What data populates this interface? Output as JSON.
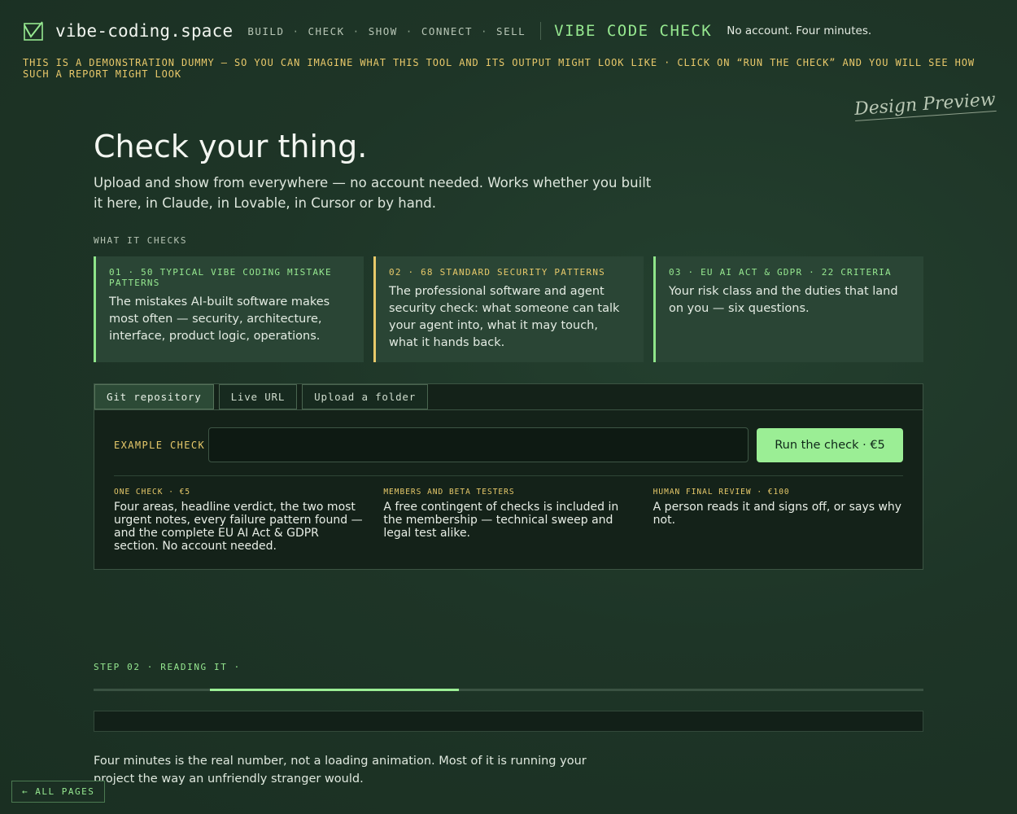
{
  "header": {
    "brand": "vibe-coding.space",
    "nav": [
      "BUILD",
      "CHECK",
      "SHOW",
      "CONNECT",
      "SELL"
    ],
    "nav_separator": "·",
    "product": "VIBE CODE CHECK",
    "tagline": "No account. Four minutes."
  },
  "banner": "THIS IS A DEMONSTRATION DUMMY — SO YOU CAN IMAGINE WHAT THIS TOOL AND ITS OUTPUT MIGHT LOOK LIKE · CLICK ON “RUN THE CHECK” AND YOU WILL SEE HOW SUCH A REPORT MIGHT LOOK",
  "preview_stamp": "Design Preview",
  "hero": {
    "title": "Check your thing.",
    "lead": "Upload and show from everywhere — no account needed. Works whether you built it here, in Claude, in Lovable, in Cursor or by hand."
  },
  "what_it_checks": {
    "label": "WHAT IT CHECKS",
    "cards": [
      {
        "title": "01 · 50 TYPICAL VIBE CODING MISTAKE PATTERNS",
        "body": "The mistakes AI-built software makes most often — security, architecture, interface, product logic, operations."
      },
      {
        "title": "02 · 68 STANDARD SECURITY PATTERNS",
        "body": "The professional software and agent security check: what someone can talk your agent into, what it may touch, what it hands back."
      },
      {
        "title": "03 · EU AI ACT & GDPR · 22 CRITERIA",
        "body": "Your risk class and the duties that land on you — six questions."
      }
    ]
  },
  "check_panel": {
    "tabs": [
      "Git repository",
      "Live URL",
      "Upload a folder"
    ],
    "active_tab": "Git repository",
    "input_label": "EXAMPLE CHECK",
    "input_value": "",
    "input_placeholder": "",
    "run_button": "Run the check · €5",
    "tiers": [
      {
        "title": "ONE CHECK · €5",
        "body": "Four areas, headline verdict, the two most urgent notes, every failure pattern found — and the complete EU AI Act & GDPR section. No account needed."
      },
      {
        "title": "MEMBERS AND BETA TESTERS",
        "body": "A free contingent of checks is included in the membership — technical sweep and legal test alike."
      },
      {
        "title": "HUMAN FINAL REVIEW · €100",
        "body": "A person reads it and signs off, or says why not."
      }
    ]
  },
  "step": {
    "label": "STEP 02 · READING IT ·",
    "progress_start": 0.14,
    "progress_fraction": 0.3,
    "note": "Four minutes is the real number, not a loading animation. Most of it is running your project the way an unfriendly stranger would."
  },
  "footer": {
    "all_pages": "← ALL PAGES"
  },
  "colors": {
    "background": "#1e3527",
    "accent_green": "#9bee95",
    "accent_yellow": "#e7c96a",
    "card_bg": "#2a4535",
    "panel_bg": "#142219"
  }
}
